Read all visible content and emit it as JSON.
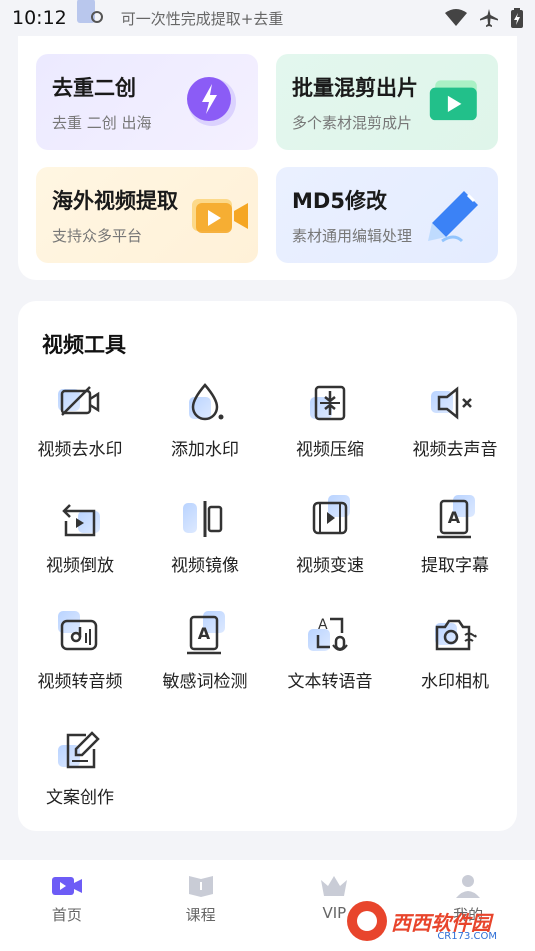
{
  "status_bar": {
    "time": "10:12",
    "marquee": "可一次性完成提取+去重",
    "icons": [
      "wifi-icon",
      "airplane-icon",
      "battery-icon"
    ]
  },
  "features": [
    {
      "title": "去重二创",
      "subtitle": "去重  二创  出海",
      "icon": "lightning-icon",
      "color": "#8b5cf6"
    },
    {
      "title": "批量混剪出片",
      "subtitle": "多个素材混剪成片",
      "icon": "video-play-icon",
      "color": "#22c08a"
    },
    {
      "title": "海外视频提取",
      "subtitle": "支持众多平台",
      "icon": "video-camera-icon",
      "color": "#f5a623"
    },
    {
      "title": "MD5修改",
      "subtitle": "素材通用编辑处理",
      "icon": "pen-icon",
      "color": "#3b82f6"
    }
  ],
  "tools": {
    "title": "视频工具",
    "items": [
      {
        "label": "视频去水印",
        "icon": "camera-off-icon"
      },
      {
        "label": "添加水印",
        "icon": "water-drop-icon"
      },
      {
        "label": "视频压缩",
        "icon": "compress-icon"
      },
      {
        "label": "视频去声音",
        "icon": "mute-icon"
      },
      {
        "label": "视频倒放",
        "icon": "reverse-icon"
      },
      {
        "label": "视频镜像",
        "icon": "mirror-icon"
      },
      {
        "label": "视频变速",
        "icon": "speed-icon"
      },
      {
        "label": "提取字幕",
        "icon": "subtitle-icon"
      },
      {
        "label": "视频转音频",
        "icon": "video-to-audio-icon"
      },
      {
        "label": "敏感词检测",
        "icon": "sensitive-word-icon"
      },
      {
        "label": "文本转语音",
        "icon": "text-to-speech-icon"
      },
      {
        "label": "水印相机",
        "icon": "watermark-camera-icon"
      },
      {
        "label": "文案创作",
        "icon": "copywriting-icon"
      }
    ]
  },
  "bottom_nav": [
    {
      "label": "首页",
      "icon": "home-video-icon",
      "active": true
    },
    {
      "label": "课程",
      "icon": "course-icon",
      "active": false
    },
    {
      "label": "VIP",
      "icon": "crown-icon",
      "active": false
    },
    {
      "label": "我的",
      "icon": "user-icon",
      "active": false
    }
  ],
  "watermark": {
    "text": "西西软件园",
    "sub": "CR173.COM"
  }
}
